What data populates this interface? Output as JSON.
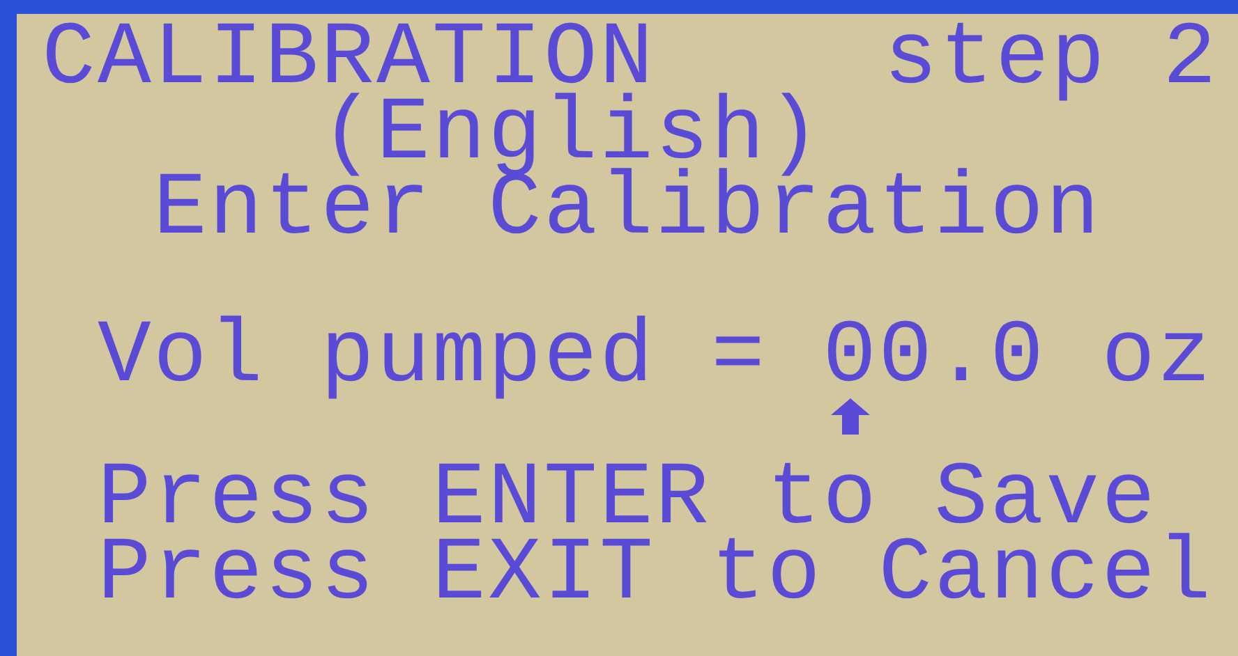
{
  "header": {
    "title": "CALIBRATION",
    "step": "step 2"
  },
  "language": "(English)",
  "instruction": "Enter Calibration",
  "entry": {
    "label": "Vol pumped =",
    "value": "00.0",
    "unit": "oz"
  },
  "prompts": [
    "Press ENTER to Save",
    "Press EXIT to Cancel"
  ]
}
